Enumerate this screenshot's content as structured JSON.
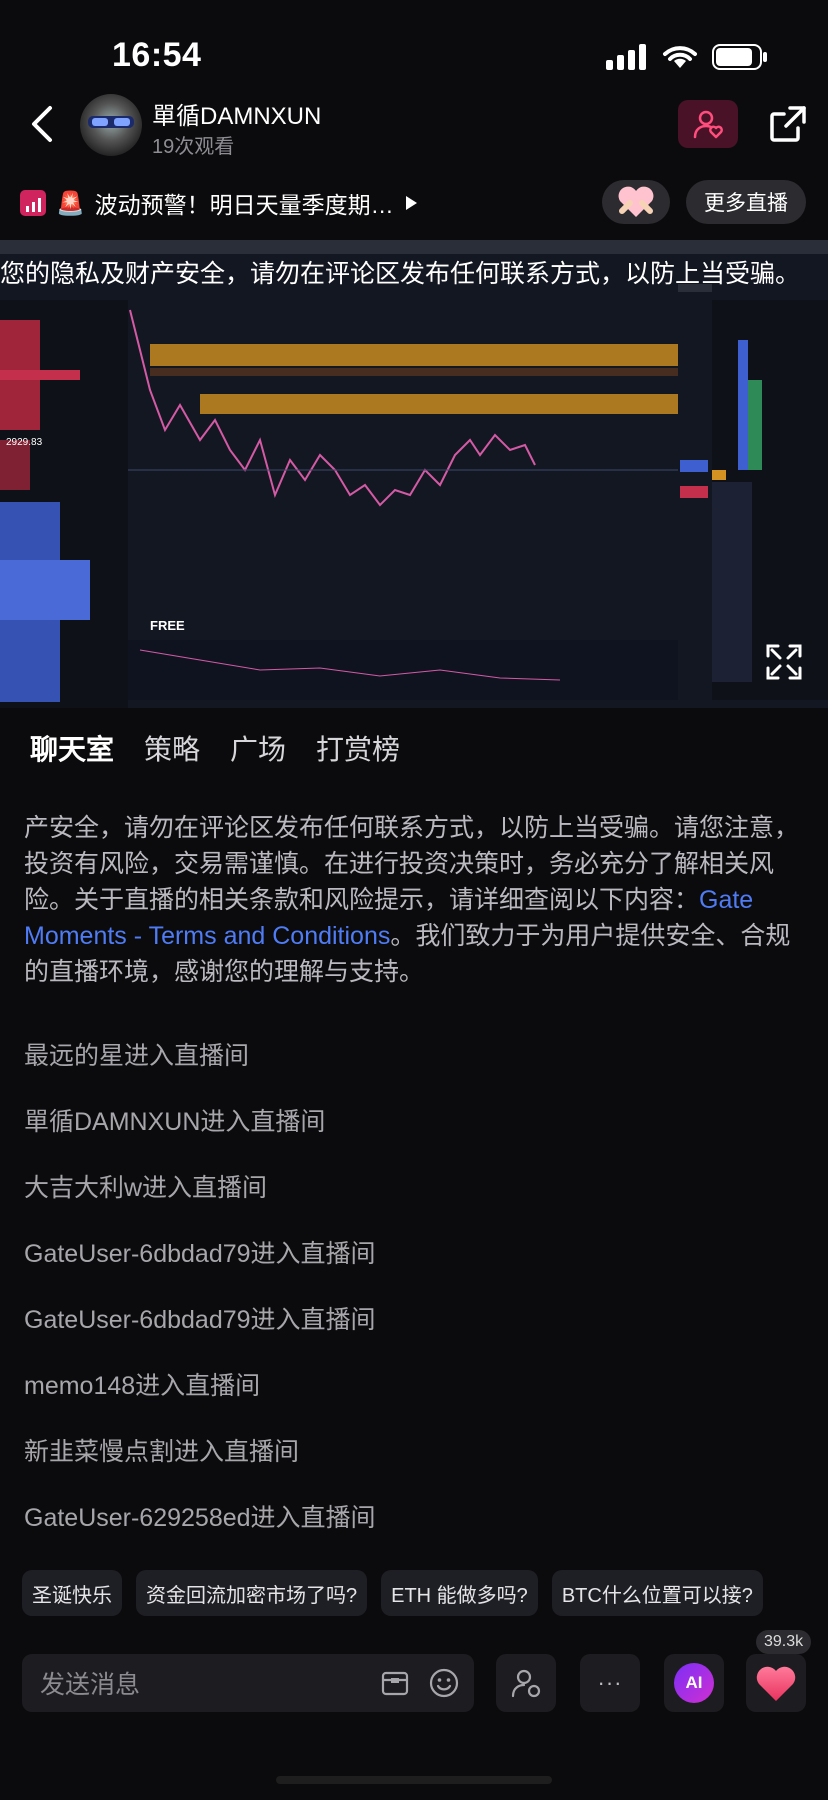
{
  "status_bar": {
    "time": "16:54"
  },
  "header": {
    "host_name": "單循DAMNXUN",
    "viewers": "19次观看"
  },
  "notice": {
    "emoji": "🚨",
    "text": "波动预警！明日天量季度期…",
    "more_live": "更多直播"
  },
  "video": {
    "warning": "您的隐私及财产安全，请勿在评论区发布任何联系方式，以防上当受骗。",
    "chart_price_label": "2929.83",
    "free_badge": "FREE"
  },
  "tabs": [
    "聊天室",
    "策略",
    "广场",
    "打赏榜"
  ],
  "chat": {
    "system_message": {
      "before": "产安全，请勿在评论区发布任何联系方式，以防上当受骗。请您注意，投资有风险，交易需谨慎。在进行投资决策时，务必充分了解相关风险。关于直播的相关条款和风险提示，请详细查阅以下内容：",
      "link": "Gate Moments - Terms and Conditions",
      "after": "。我们致力于为用户提供安全、合规的直播环境，感谢您的理解与支持。"
    },
    "entries": [
      "最远的星进入直播间",
      "單循DAMNXUN进入直播间",
      "大吉大利w进入直播间",
      "GateUser-6dbdad79进入直播间",
      "GateUser-6dbdad79进入直播间",
      "memo148进入直播间",
      "新韭菜慢点割进入直播间",
      "GateUser-629258ed进入直播间"
    ]
  },
  "quick_chips": [
    "圣诞快乐",
    "资金回流加密市场了吗?",
    "ETH 能做多吗?",
    "BTC什么位置可以接?"
  ],
  "bottom_bar": {
    "input_placeholder": "发送消息",
    "more": "···",
    "ai": "AI",
    "like_count": "39.3k"
  },
  "colors": {
    "accent_pink": "#e8335e",
    "link_blue": "#4f7cf5",
    "ai_purple": "#7b2ff7"
  }
}
